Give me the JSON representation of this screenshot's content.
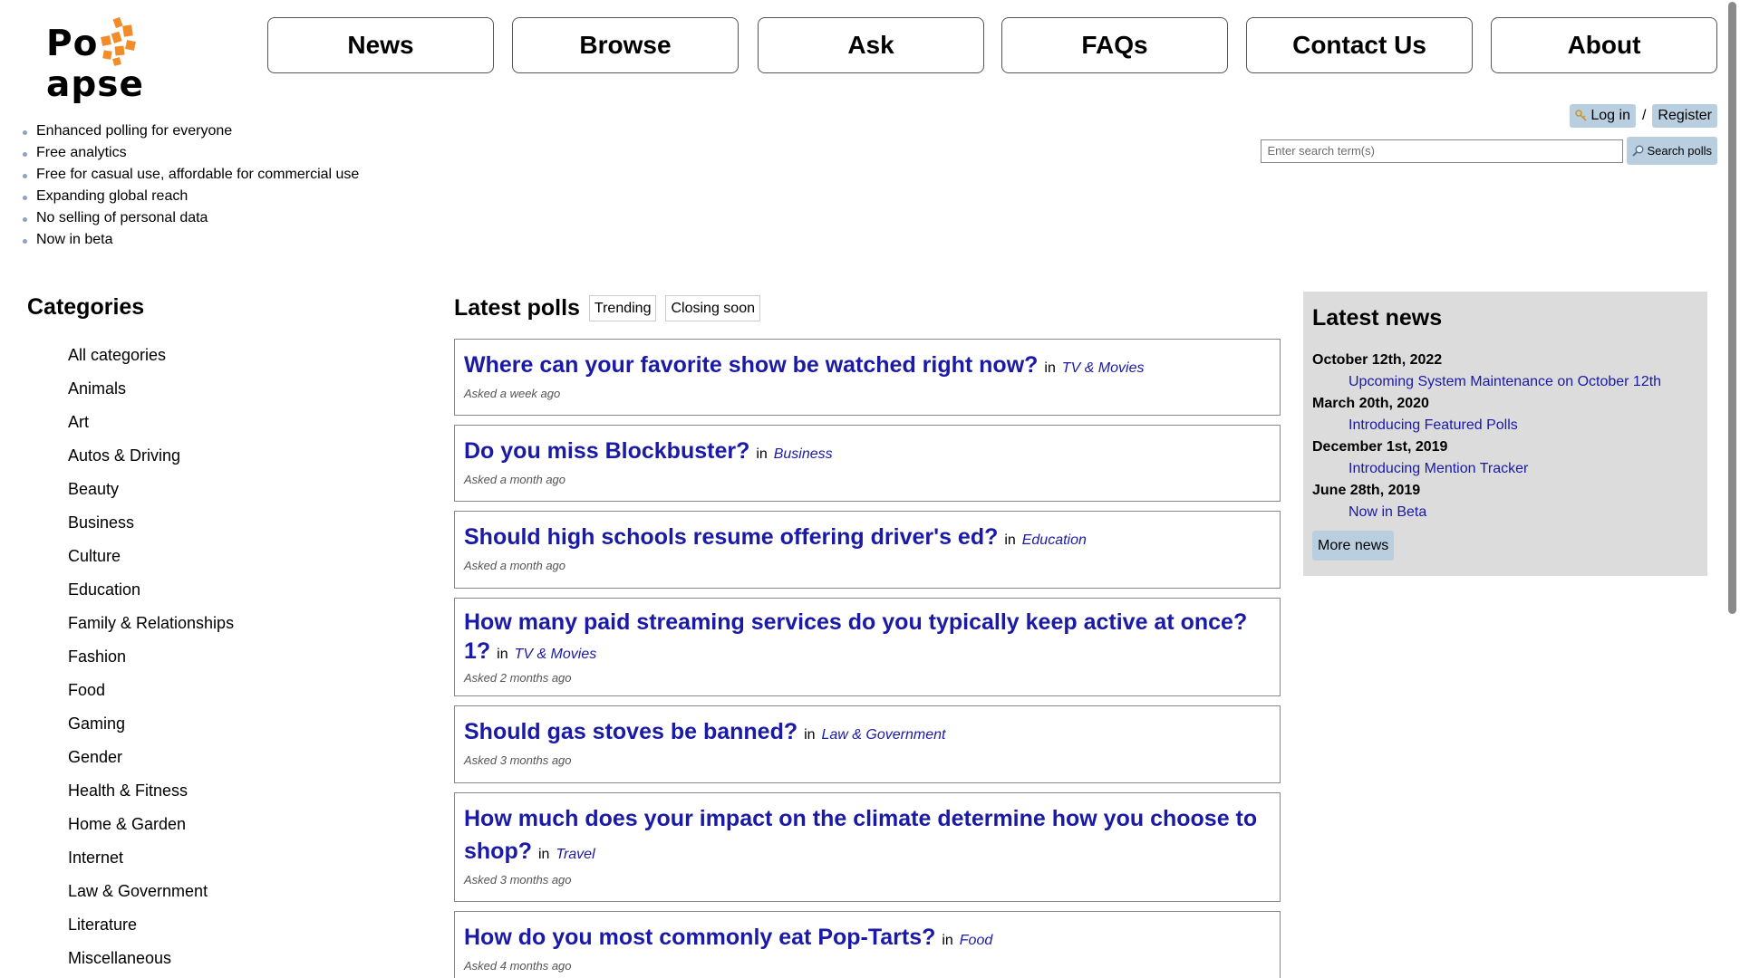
{
  "header": {
    "logo_left": "Po",
    "logo_right": "apse"
  },
  "nav": [
    {
      "label": "News"
    },
    {
      "label": "Browse"
    },
    {
      "label": "Ask"
    },
    {
      "label": "FAQs"
    },
    {
      "label": "Contact Us"
    },
    {
      "label": "About"
    }
  ],
  "account": {
    "login_label": "Log in",
    "separator": "/",
    "register_label": "Register"
  },
  "search": {
    "placeholder": "Enter search term(s)",
    "button_label": "Search polls"
  },
  "features": [
    "Enhanced polling for everyone",
    "Free analytics",
    "Free for casual use, affordable for commercial use",
    "Expanding global reach",
    "No selling of personal data",
    "Now in beta"
  ],
  "categories": {
    "title": "Categories",
    "items": [
      "All categories",
      "Animals",
      "Art",
      "Autos & Driving",
      "Beauty",
      "Business",
      "Culture",
      "Education",
      "Family & Relationships",
      "Fashion",
      "Food",
      "Gaming",
      "Gender",
      "Health & Fitness",
      "Home & Garden",
      "Internet",
      "Law & Government",
      "Literature",
      "Miscellaneous"
    ]
  },
  "polls": {
    "title": "Latest polls",
    "tabs": [
      "Trending",
      "Closing soon"
    ],
    "in_word": "in",
    "items": [
      {
        "question": "Where can your favorite show be watched right now?",
        "category": "TV & Movies",
        "asked": "Asked a week ago"
      },
      {
        "question": "Do you miss Blockbuster?",
        "category": "Business",
        "asked": "Asked a month ago"
      },
      {
        "question": "Should high schools resume offering driver's ed?",
        "category": "Education",
        "asked": "Asked a month ago"
      },
      {
        "question": "How many paid streaming services do you typically keep active at once?1?",
        "category": "TV & Movies",
        "asked": "Asked 2 months ago"
      },
      {
        "question": "Should gas stoves be banned?",
        "category": "Law & Government",
        "asked": "Asked 3 months ago"
      },
      {
        "question": "How much does your impact on the climate determine how you choose to shop?",
        "category": "Travel",
        "asked": "Asked 3 months ago"
      },
      {
        "question": "How do you most commonly eat Pop-Tarts?",
        "category": "Food",
        "asked": "Asked 4 months ago"
      }
    ]
  },
  "news": {
    "title": "Latest news",
    "entries": [
      {
        "date": "October 12th, 2022",
        "item": "Upcoming System Maintenance on October 12th"
      },
      {
        "date": "March 20th, 2020",
        "item": "Introducing Featured Polls"
      },
      {
        "date": "December 1st, 2019",
        "item": "Introducing Mention Tracker"
      },
      {
        "date": "June 28th, 2019",
        "item": "Now in Beta"
      }
    ],
    "more_label": "More news"
  },
  "colors": {
    "link": "#1a1aa6",
    "button_bg": "#b9cfe0",
    "news_bg": "#dcdcdc",
    "logo_orange": "#f28c28"
  },
  "icons": {
    "login": "key-icon",
    "search": "magnifier-icon"
  }
}
